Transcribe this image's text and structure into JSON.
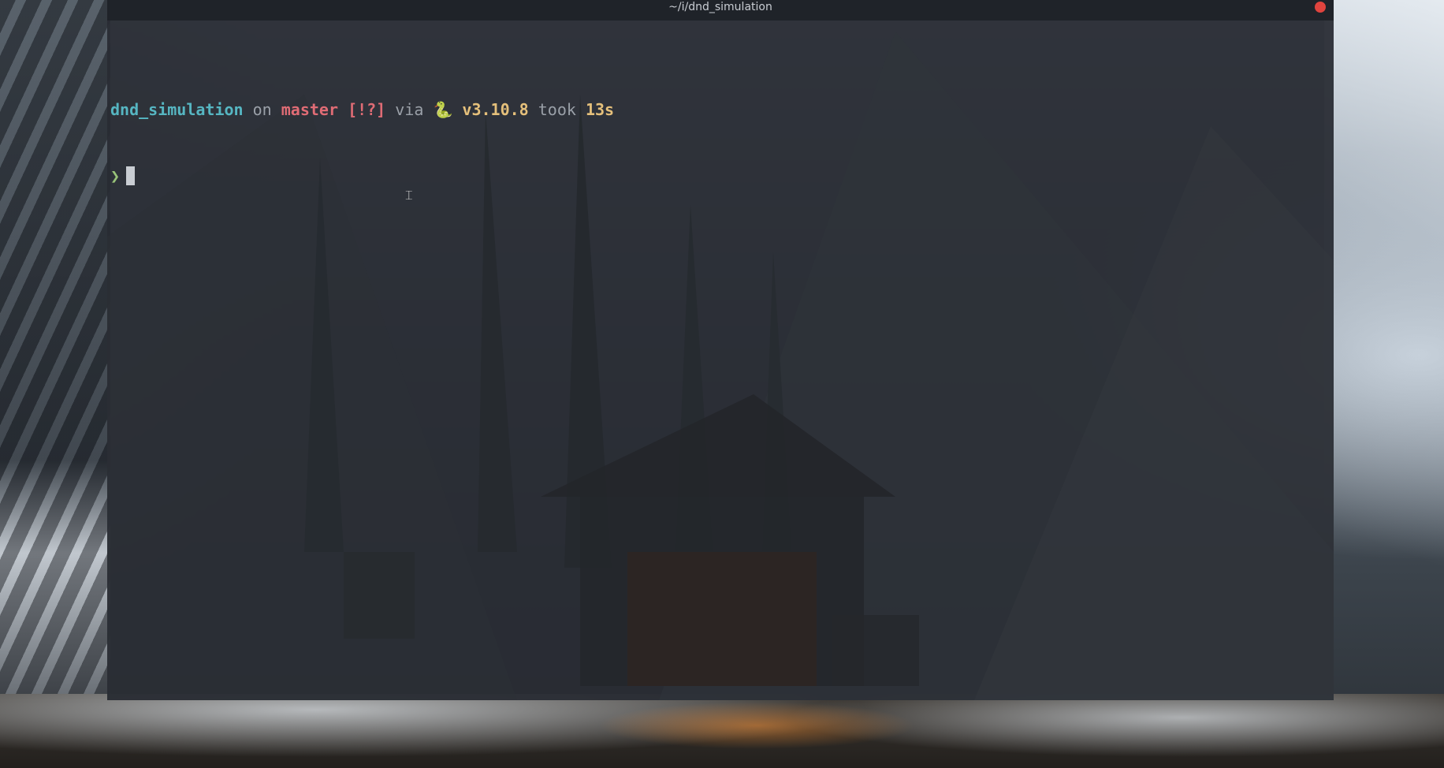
{
  "window": {
    "title": "~/i/dnd_simulation"
  },
  "prompt": {
    "directory": "dnd_simulation",
    "on_word": "on",
    "branch_icon": "git-branch-icon",
    "branch_glyph": "",
    "branch": "master",
    "status": "[!?]",
    "via_word": "via",
    "python_icon": "python-icon",
    "python_glyph": "🐍",
    "version": "v3.10.8",
    "took_word": "took",
    "duration": "13s",
    "prompt_char": "❯"
  },
  "colors": {
    "directory": "#56b6c2",
    "branch": "#e06c75",
    "version": "#e5c07b",
    "prompt_char": "#98c379",
    "close_button": "#e0443e"
  }
}
